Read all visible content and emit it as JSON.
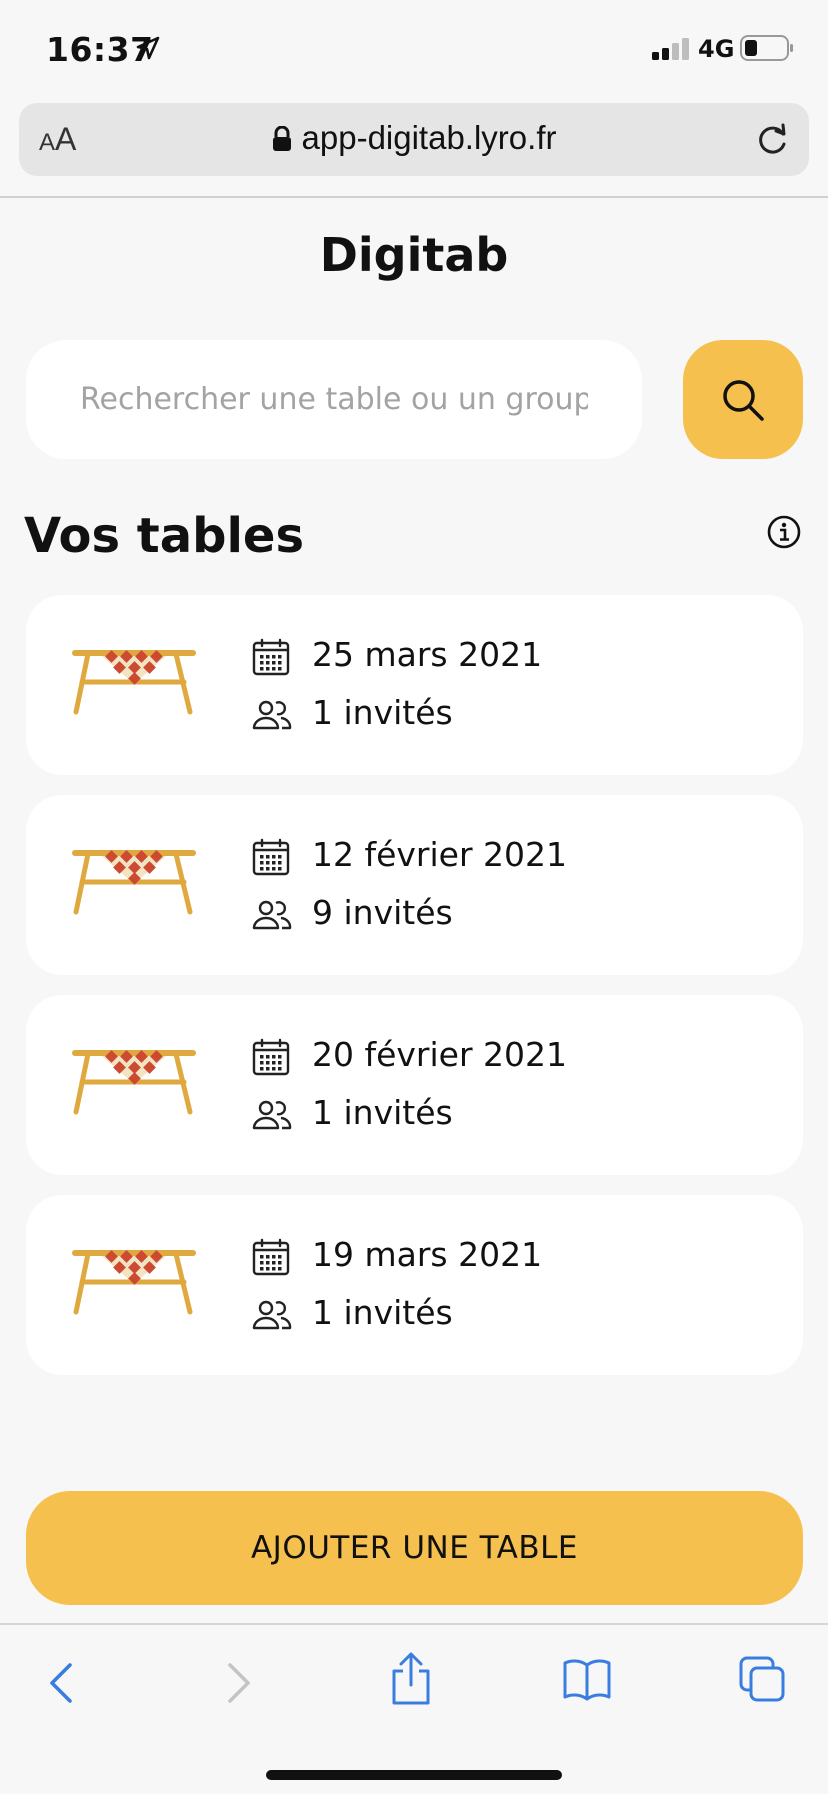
{
  "status_bar": {
    "time": "16:37",
    "network": "4G"
  },
  "browser": {
    "aa_small": "A",
    "aa_large": "A",
    "url": "app-digitab.lyro.fr"
  },
  "app": {
    "title": "Digitab"
  },
  "search": {
    "placeholder": "Rechercher une table ou un groupe"
  },
  "section": {
    "title": "Vos tables"
  },
  "tables": [
    {
      "date": "25 mars 2021",
      "guests": "1 invités"
    },
    {
      "date": "12 février 2021",
      "guests": "9 invités"
    },
    {
      "date": "20 février 2021",
      "guests": "1 invités"
    },
    {
      "date": "19 mars 2021",
      "guests": "1 invités"
    }
  ],
  "actions": {
    "add_table": "AJOUTER UNE TABLE"
  },
  "icons": {
    "search": "search-icon",
    "info": "info-icon",
    "calendar": "calendar-icon",
    "guests": "users-icon",
    "table": "picnic-table-icon"
  },
  "colors": {
    "accent": "#f5c04e",
    "ios_blue": "#3a7de0",
    "background": "#f7f7f7",
    "cloth_red": "#cc4a32"
  }
}
